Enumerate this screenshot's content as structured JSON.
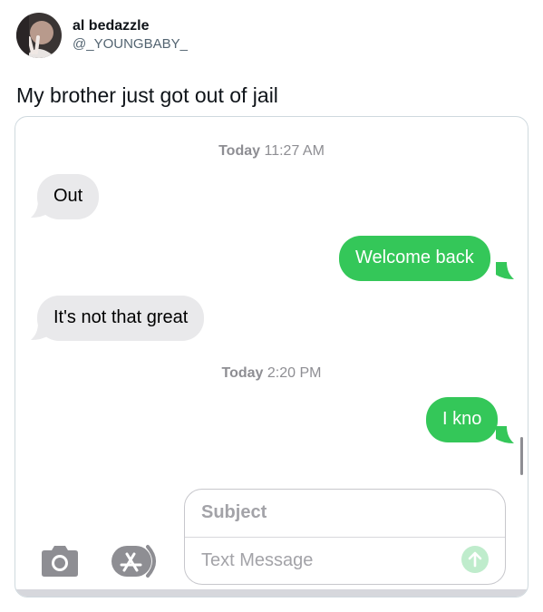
{
  "tweet": {
    "display_name": "al bedazzle",
    "handle": "@_YOUNGBABY_",
    "text": "My brother just got out of jail"
  },
  "conversation": {
    "messages": [
      {
        "type": "timestamp",
        "day": "Today",
        "time": "11:27 AM"
      },
      {
        "type": "received",
        "text": "Out"
      },
      {
        "type": "sent",
        "text": "Welcome back"
      },
      {
        "type": "received",
        "text": "It's not that great"
      },
      {
        "type": "timestamp",
        "day": "Today",
        "time": "2:20 PM"
      },
      {
        "type": "sent",
        "text": "I kno"
      }
    ]
  },
  "composer": {
    "subject_placeholder": "Subject",
    "message_placeholder": "Text Message",
    "icons": {
      "camera": "camera-icon",
      "app_store": "app-store-icon",
      "send": "send-arrow-icon"
    }
  },
  "colors": {
    "sent_bubble": "#34c759",
    "received_bubble": "#e9e9eb",
    "send_button_disabled": "#bfeccc",
    "handle_gray": "#536471"
  }
}
